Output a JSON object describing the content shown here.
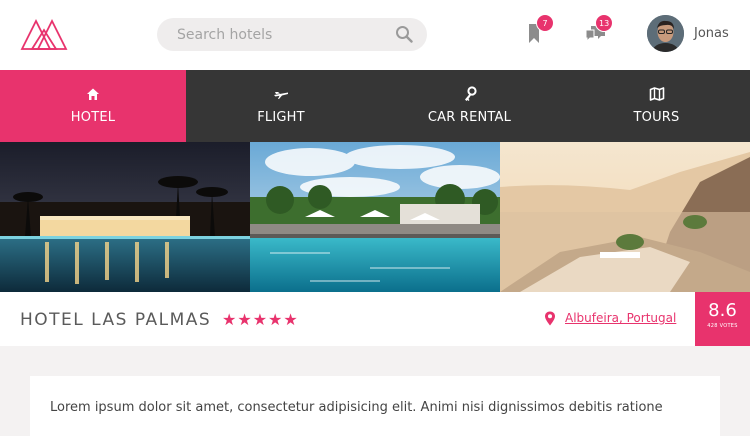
{
  "header": {
    "search": {
      "placeholder": "Search hotels",
      "value": ""
    },
    "bookmarks_count": "7",
    "messages_count": "13",
    "user_name": "Jonas"
  },
  "nav": {
    "tabs": [
      {
        "label": "HOTEL",
        "icon": "home-icon",
        "active": true
      },
      {
        "label": "FLIGHT",
        "icon": "plane-icon",
        "active": false
      },
      {
        "label": "CAR RENTAL",
        "icon": "key-icon",
        "active": false
      },
      {
        "label": "TOURS",
        "icon": "map-icon",
        "active": false
      }
    ]
  },
  "hotel": {
    "name": "HOTEL LAS PALMAS",
    "stars": "★★★★★",
    "rating": 5,
    "location": "Albufeira, Portugal",
    "score": "8.6",
    "votes": "428 VOTES",
    "description": "Lorem ipsum dolor sit amet, consectetur adipisicing elit. Animi nisi dignissimos debitis ratione"
  },
  "colors": {
    "accent": "#e8336d",
    "nav_background": "#363636",
    "page_background": "#f4f2f2"
  }
}
